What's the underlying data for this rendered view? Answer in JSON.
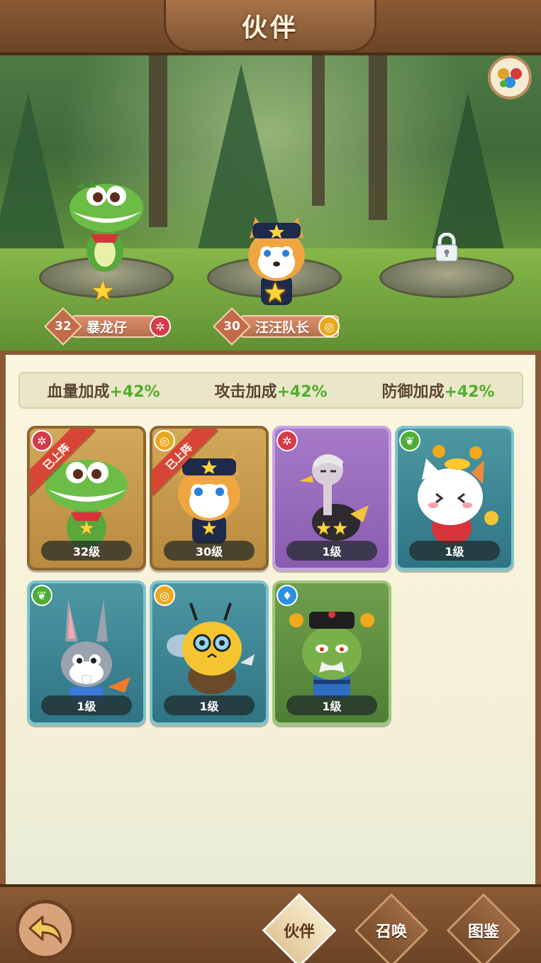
{
  "header": {
    "title": "伙伴"
  },
  "scene": {
    "slots": [
      {
        "level": "32",
        "name": "暴龙仔",
        "element": "fire",
        "stars": "★",
        "character": "green-crocodile"
      },
      {
        "level": "30",
        "name": "汪汪队长",
        "element": "gold",
        "stars": "★",
        "character": "police-dog"
      },
      {
        "locked": true
      }
    ]
  },
  "bonuses": [
    {
      "label": "血量加成",
      "value": "+42%"
    },
    {
      "label": "攻击加成",
      "value": "+42%"
    },
    {
      "label": "防御加成",
      "value": "+42%"
    }
  ],
  "partners": [
    {
      "level_text": "32级",
      "element": "fire",
      "frame": "gold",
      "deployed": true,
      "ribbon": "已上阵",
      "stars": "★",
      "character": "green-crocodile"
    },
    {
      "level_text": "30级",
      "element": "gold",
      "frame": "gold",
      "deployed": true,
      "ribbon": "已上阵",
      "stars": "★",
      "character": "police-dog"
    },
    {
      "level_text": "1级",
      "element": "fire",
      "frame": "purple",
      "deployed": false,
      "stars": "★★",
      "character": "ostrich"
    },
    {
      "level_text": "1级",
      "element": "leaf",
      "frame": "teal",
      "deployed": false,
      "stars": "",
      "character": "lucky-cat"
    },
    {
      "level_text": "1级",
      "element": "leaf",
      "frame": "teal",
      "deployed": false,
      "stars": "",
      "character": "bunny"
    },
    {
      "level_text": "1级",
      "element": "gold",
      "frame": "teal",
      "deployed": false,
      "stars": "",
      "character": "bee"
    },
    {
      "level_text": "1级",
      "element": "water",
      "frame": "green",
      "deployed": false,
      "stars": "",
      "character": "frog-sage"
    }
  ],
  "nav": {
    "tabs": [
      {
        "label": "伙伴",
        "active": true
      },
      {
        "label": "召唤",
        "active": false
      },
      {
        "label": "图鉴",
        "active": false
      }
    ]
  },
  "colors": {
    "bonus_value": "#4fae2b",
    "ribbon": "#d74635",
    "frame_brown": "#8a5a35"
  }
}
